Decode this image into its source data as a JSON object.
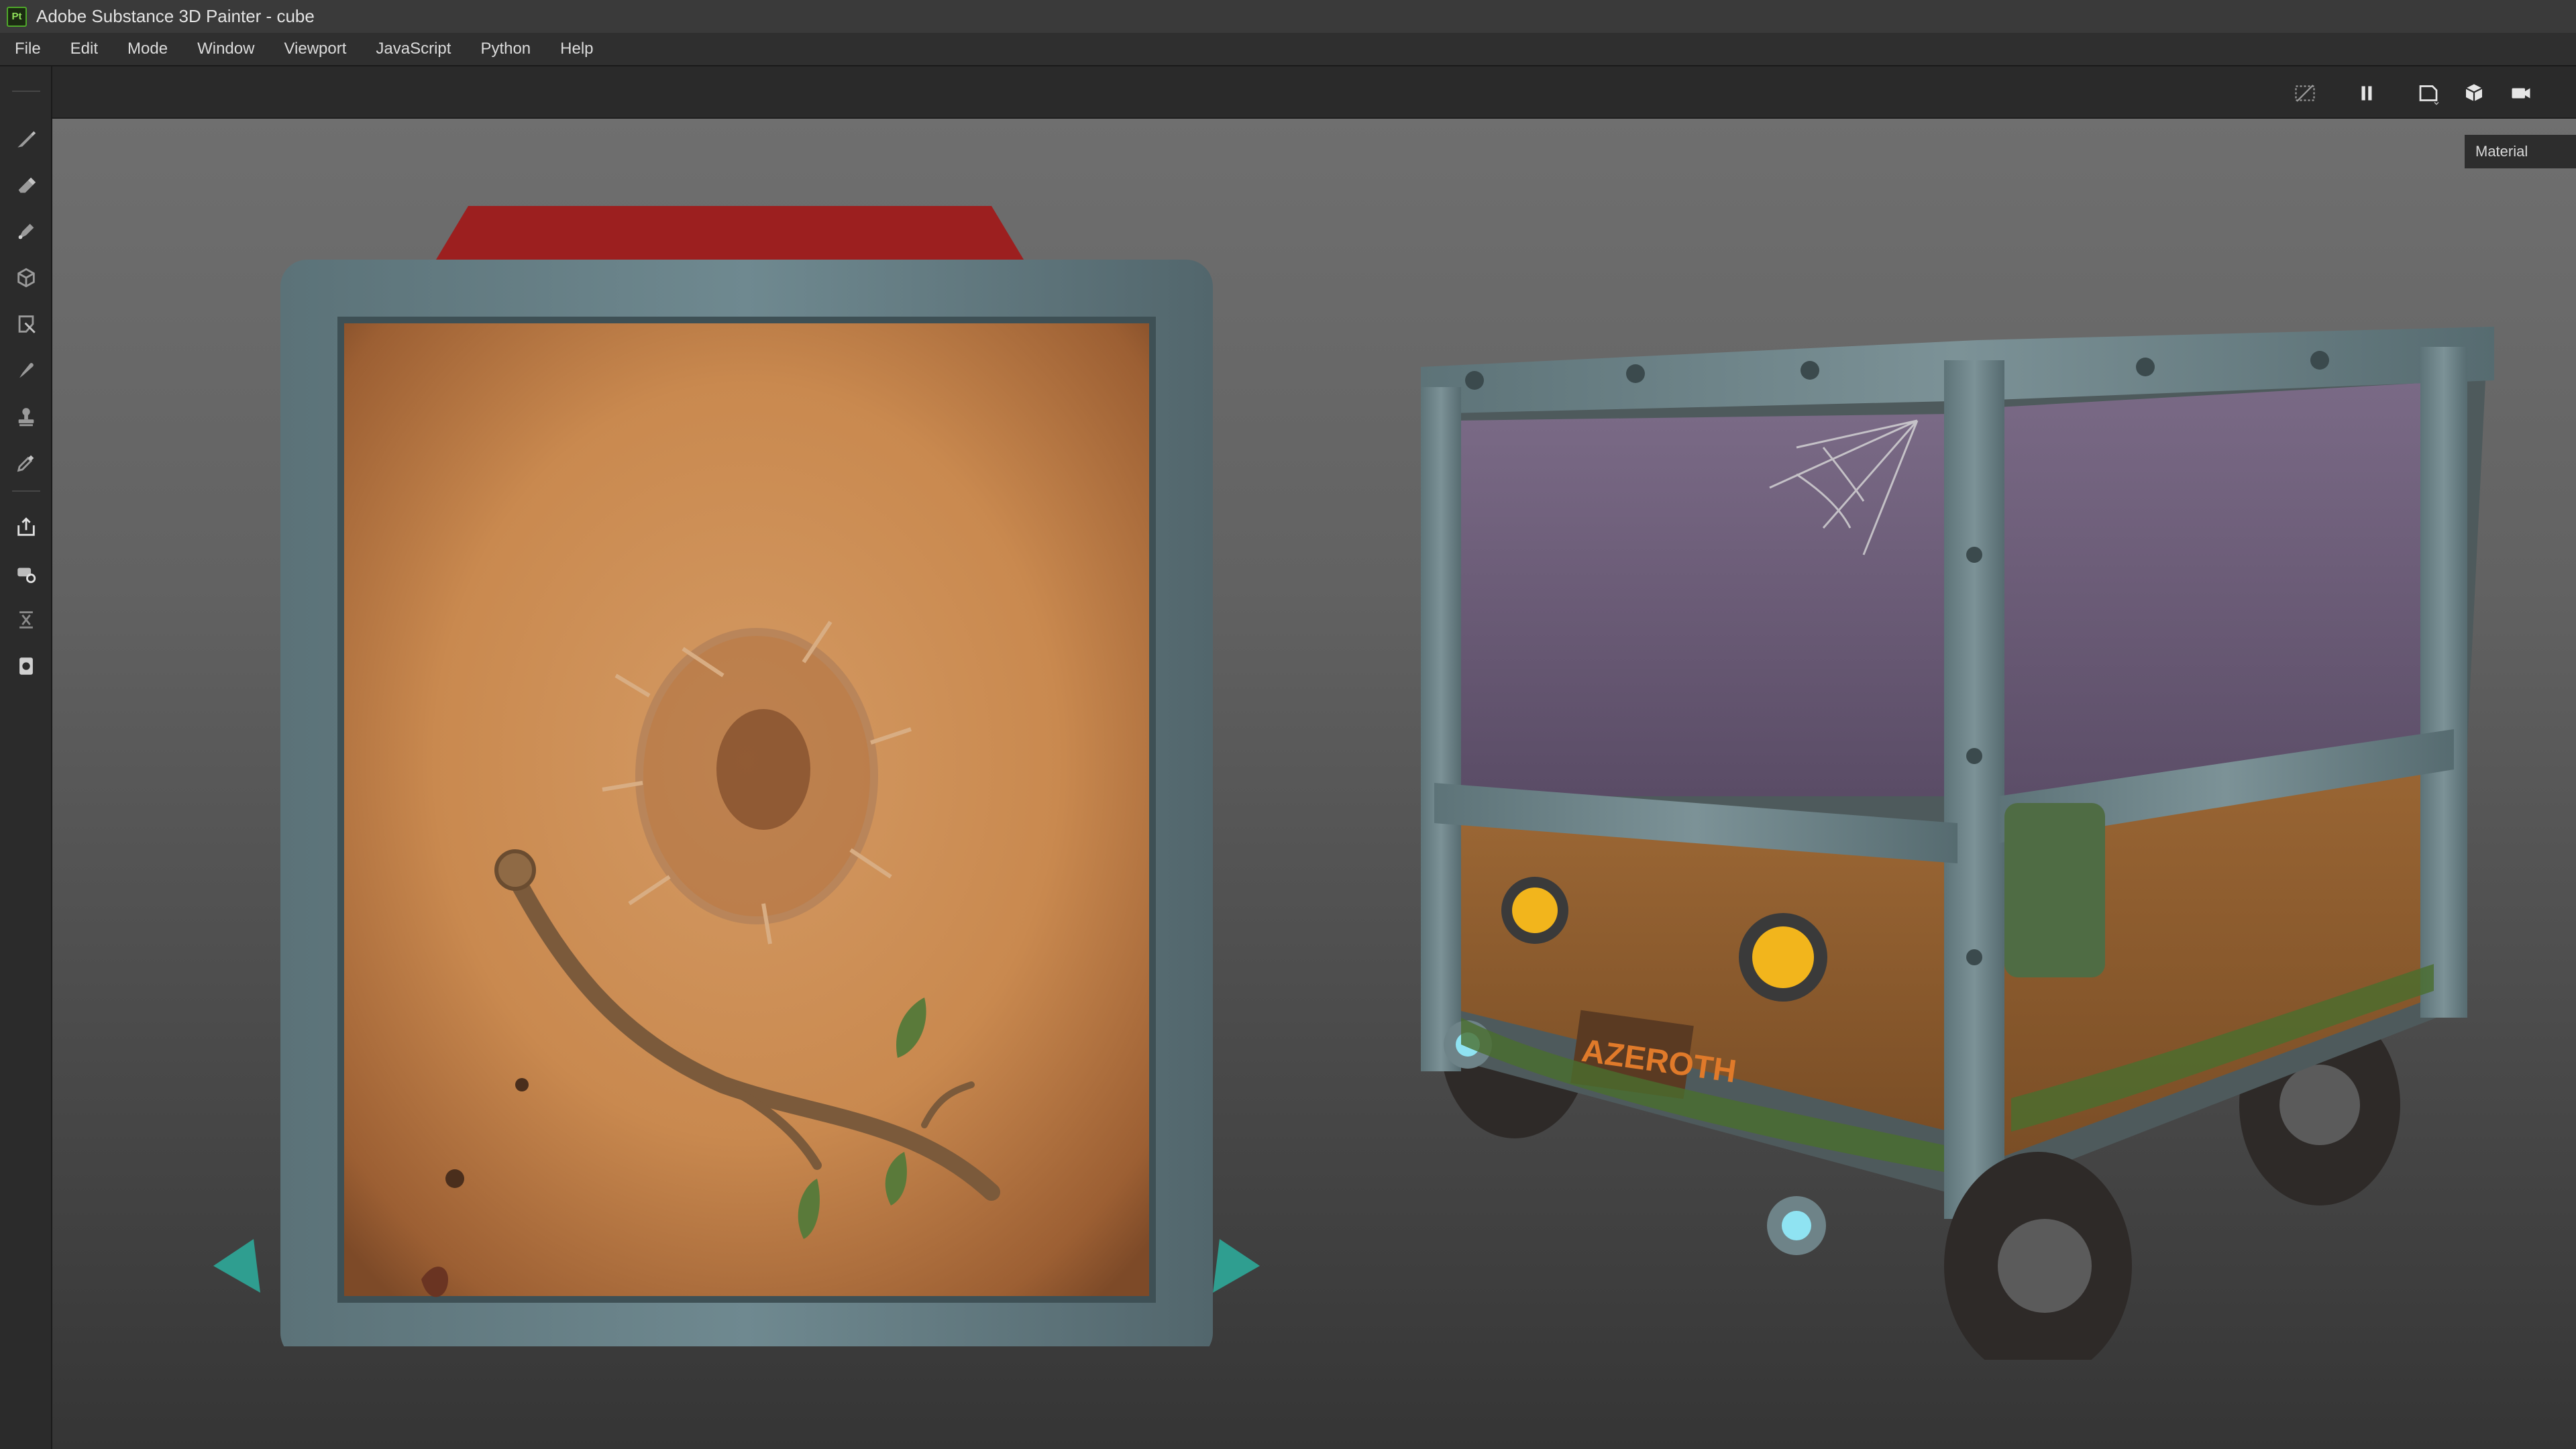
{
  "window": {
    "title": "Adobe Substance 3D Painter - cube",
    "app_badge": "Pt"
  },
  "menu": {
    "items": [
      "File",
      "Edit",
      "Mode",
      "Window",
      "Viewport",
      "JavaScript",
      "Python",
      "Help"
    ]
  },
  "viewport_toolbar": {
    "buttons": [
      "hide-overlay-icon",
      "pause-icon",
      "frame-select-icon",
      "display-mode-icon",
      "camera-icon"
    ]
  },
  "left_toolbar": {
    "tools": [
      "paint-brush-icon",
      "eraser-icon",
      "projection-icon",
      "geometry-mask-icon",
      "polygon-fill-icon",
      "smudge-icon",
      "clone-stamp-icon",
      "color-picker-icon",
      "bake-icon",
      "measure-icon",
      "align-icon",
      "export-icon"
    ]
  },
  "viewport": {
    "channel_label": "Material",
    "plate_text": "AZEROTH"
  },
  "colors": {
    "accent_green": "#4fa82a",
    "metal_frame": "#5f7a80",
    "parchment": "#c98a52",
    "wood": "#8b5a2c",
    "headlight": "#f2b51c",
    "red_handle": "#a32222"
  }
}
